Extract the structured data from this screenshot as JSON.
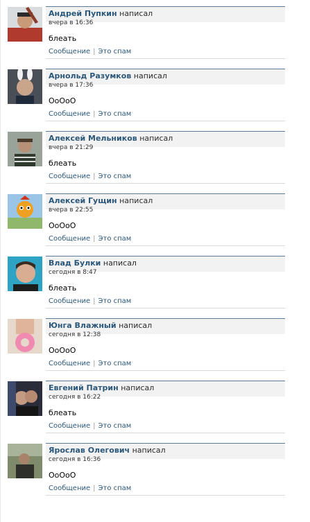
{
  "wall": {
    "posts": [
      {
        "author": "Андрей Пупкин",
        "action": "написал",
        "time": "вчера в 16:36",
        "text": "блеать",
        "reply": "Сообщение",
        "spam": "Это спам",
        "avatar": "avatar-icon"
      },
      {
        "author": "Арнольд Разумков",
        "action": "написал",
        "time": "вчера в 17:36",
        "text": "OoOoO",
        "reply": "Сообщение",
        "spam": "Это спам",
        "avatar": "avatar-icon"
      },
      {
        "author": "Алексей Мельников",
        "action": "написал",
        "time": "вчера в 21:29",
        "text": "блеать",
        "reply": "Сообщение",
        "spam": "Это спам",
        "avatar": "avatar-icon"
      },
      {
        "author": "Алексей Гущин",
        "action": "написал",
        "time": "вчера в 22:55",
        "text": "OoOoO",
        "reply": "Сообщение",
        "spam": "Это спам",
        "avatar": "avatar-icon"
      },
      {
        "author": "Влад Булки",
        "action": "написал",
        "time": "сегодня в 8:47",
        "text": "блеать",
        "reply": "Сообщение",
        "spam": "Это спам",
        "avatar": "avatar-icon"
      },
      {
        "author": "Юнга Влажный",
        "action": "написал",
        "time": "сегодня в 12:38",
        "text": "OoOoO",
        "reply": "Сообщение",
        "spam": "Это спам",
        "avatar": "avatar-icon"
      },
      {
        "author": "Евгений Патрин",
        "action": "написал",
        "time": "сегодня в 16:22",
        "text": "блеать",
        "reply": "Сообщение",
        "spam": "Это спам",
        "avatar": "avatar-icon"
      },
      {
        "author": "Ярослав Олегович",
        "action": "написал",
        "time": "сегодня в 16:36",
        "text": "OoOoO",
        "reply": "Сообщение",
        "spam": "Это спам",
        "avatar": "avatar-icon"
      }
    ]
  },
  "colors": {
    "author_link": "#2b587a",
    "header_rule": "#5b7a9c",
    "header_bg": "#f2f2f2"
  }
}
